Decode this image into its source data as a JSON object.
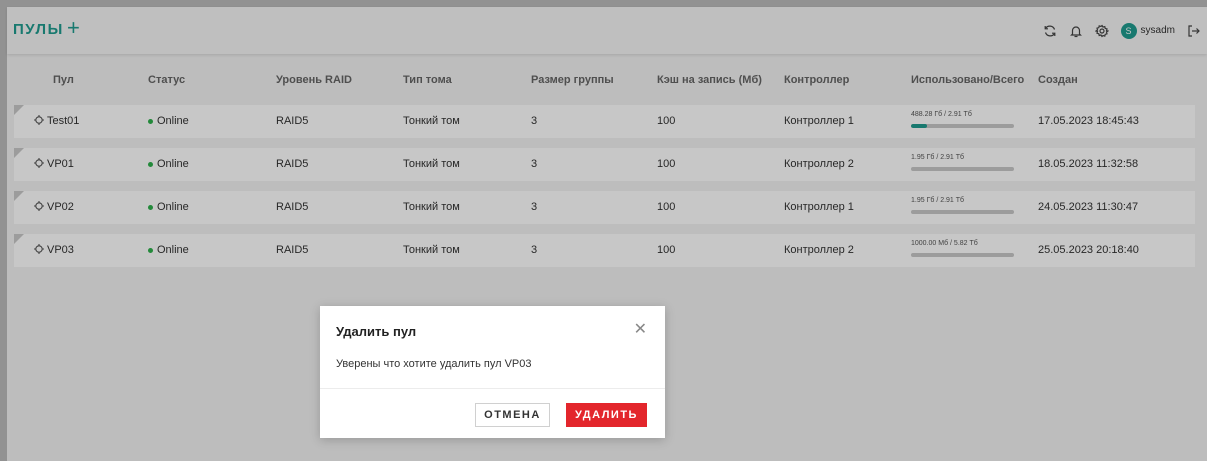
{
  "header": {
    "title": "ПУЛЫ",
    "add_label": "+",
    "username": "sysadm",
    "avatar_letter": "S",
    "icons": [
      "refresh-icon",
      "bell-icon",
      "gear-icon",
      "logout-icon"
    ]
  },
  "table": {
    "columns": [
      "Пул",
      "Статус",
      "Уровень RAID",
      "Тип тома",
      "Размер группы",
      "Кэш на запись (Мб)",
      "Контроллер",
      "Использовано/Всего",
      "Создан"
    ],
    "rows": [
      {
        "name": "Test01",
        "status": "Online",
        "raid": "RAID5",
        "volume_type": "Тонкий том",
        "group_size": "3",
        "cache": "100",
        "controller": "Контроллер 1",
        "usage_label": "488.28 Гб / 2.91 Тб",
        "usage_fraction": 0.16,
        "created": "17.05.2023 18:45:43"
      },
      {
        "name": "VP01",
        "status": "Online",
        "raid": "RAID5",
        "volume_type": "Тонкий том",
        "group_size": "3",
        "cache": "100",
        "controller": "Контроллер 2",
        "usage_label": "1.95 Гб / 2.91 Тб",
        "usage_fraction": 0.0,
        "created": "18.05.2023 11:32:58"
      },
      {
        "name": "VP02",
        "status": "Online",
        "raid": "RAID5",
        "volume_type": "Тонкий том",
        "group_size": "3",
        "cache": "100",
        "controller": "Контроллер 1",
        "usage_label": "1.95 Гб / 2.91 Тб",
        "usage_fraction": 0.0,
        "created": "24.05.2023 11:30:47"
      },
      {
        "name": "VP03",
        "status": "Online",
        "raid": "RAID5",
        "volume_type": "Тонкий том",
        "group_size": "3",
        "cache": "100",
        "controller": "Контроллер 2",
        "usage_label": "1000.00 Мб / 5.82 Тб",
        "usage_fraction": 0.0,
        "created": "25.05.2023 20:18:40"
      }
    ]
  },
  "modal": {
    "title": "Удалить пул",
    "message": "Уверены что хотите удалить пул VP03",
    "cancel_label": "ОТМЕНА",
    "delete_label": "УДАЛИТЬ"
  },
  "colors": {
    "accent": "#1f9c8f",
    "danger": "#e3262c",
    "online": "#2db04b"
  }
}
